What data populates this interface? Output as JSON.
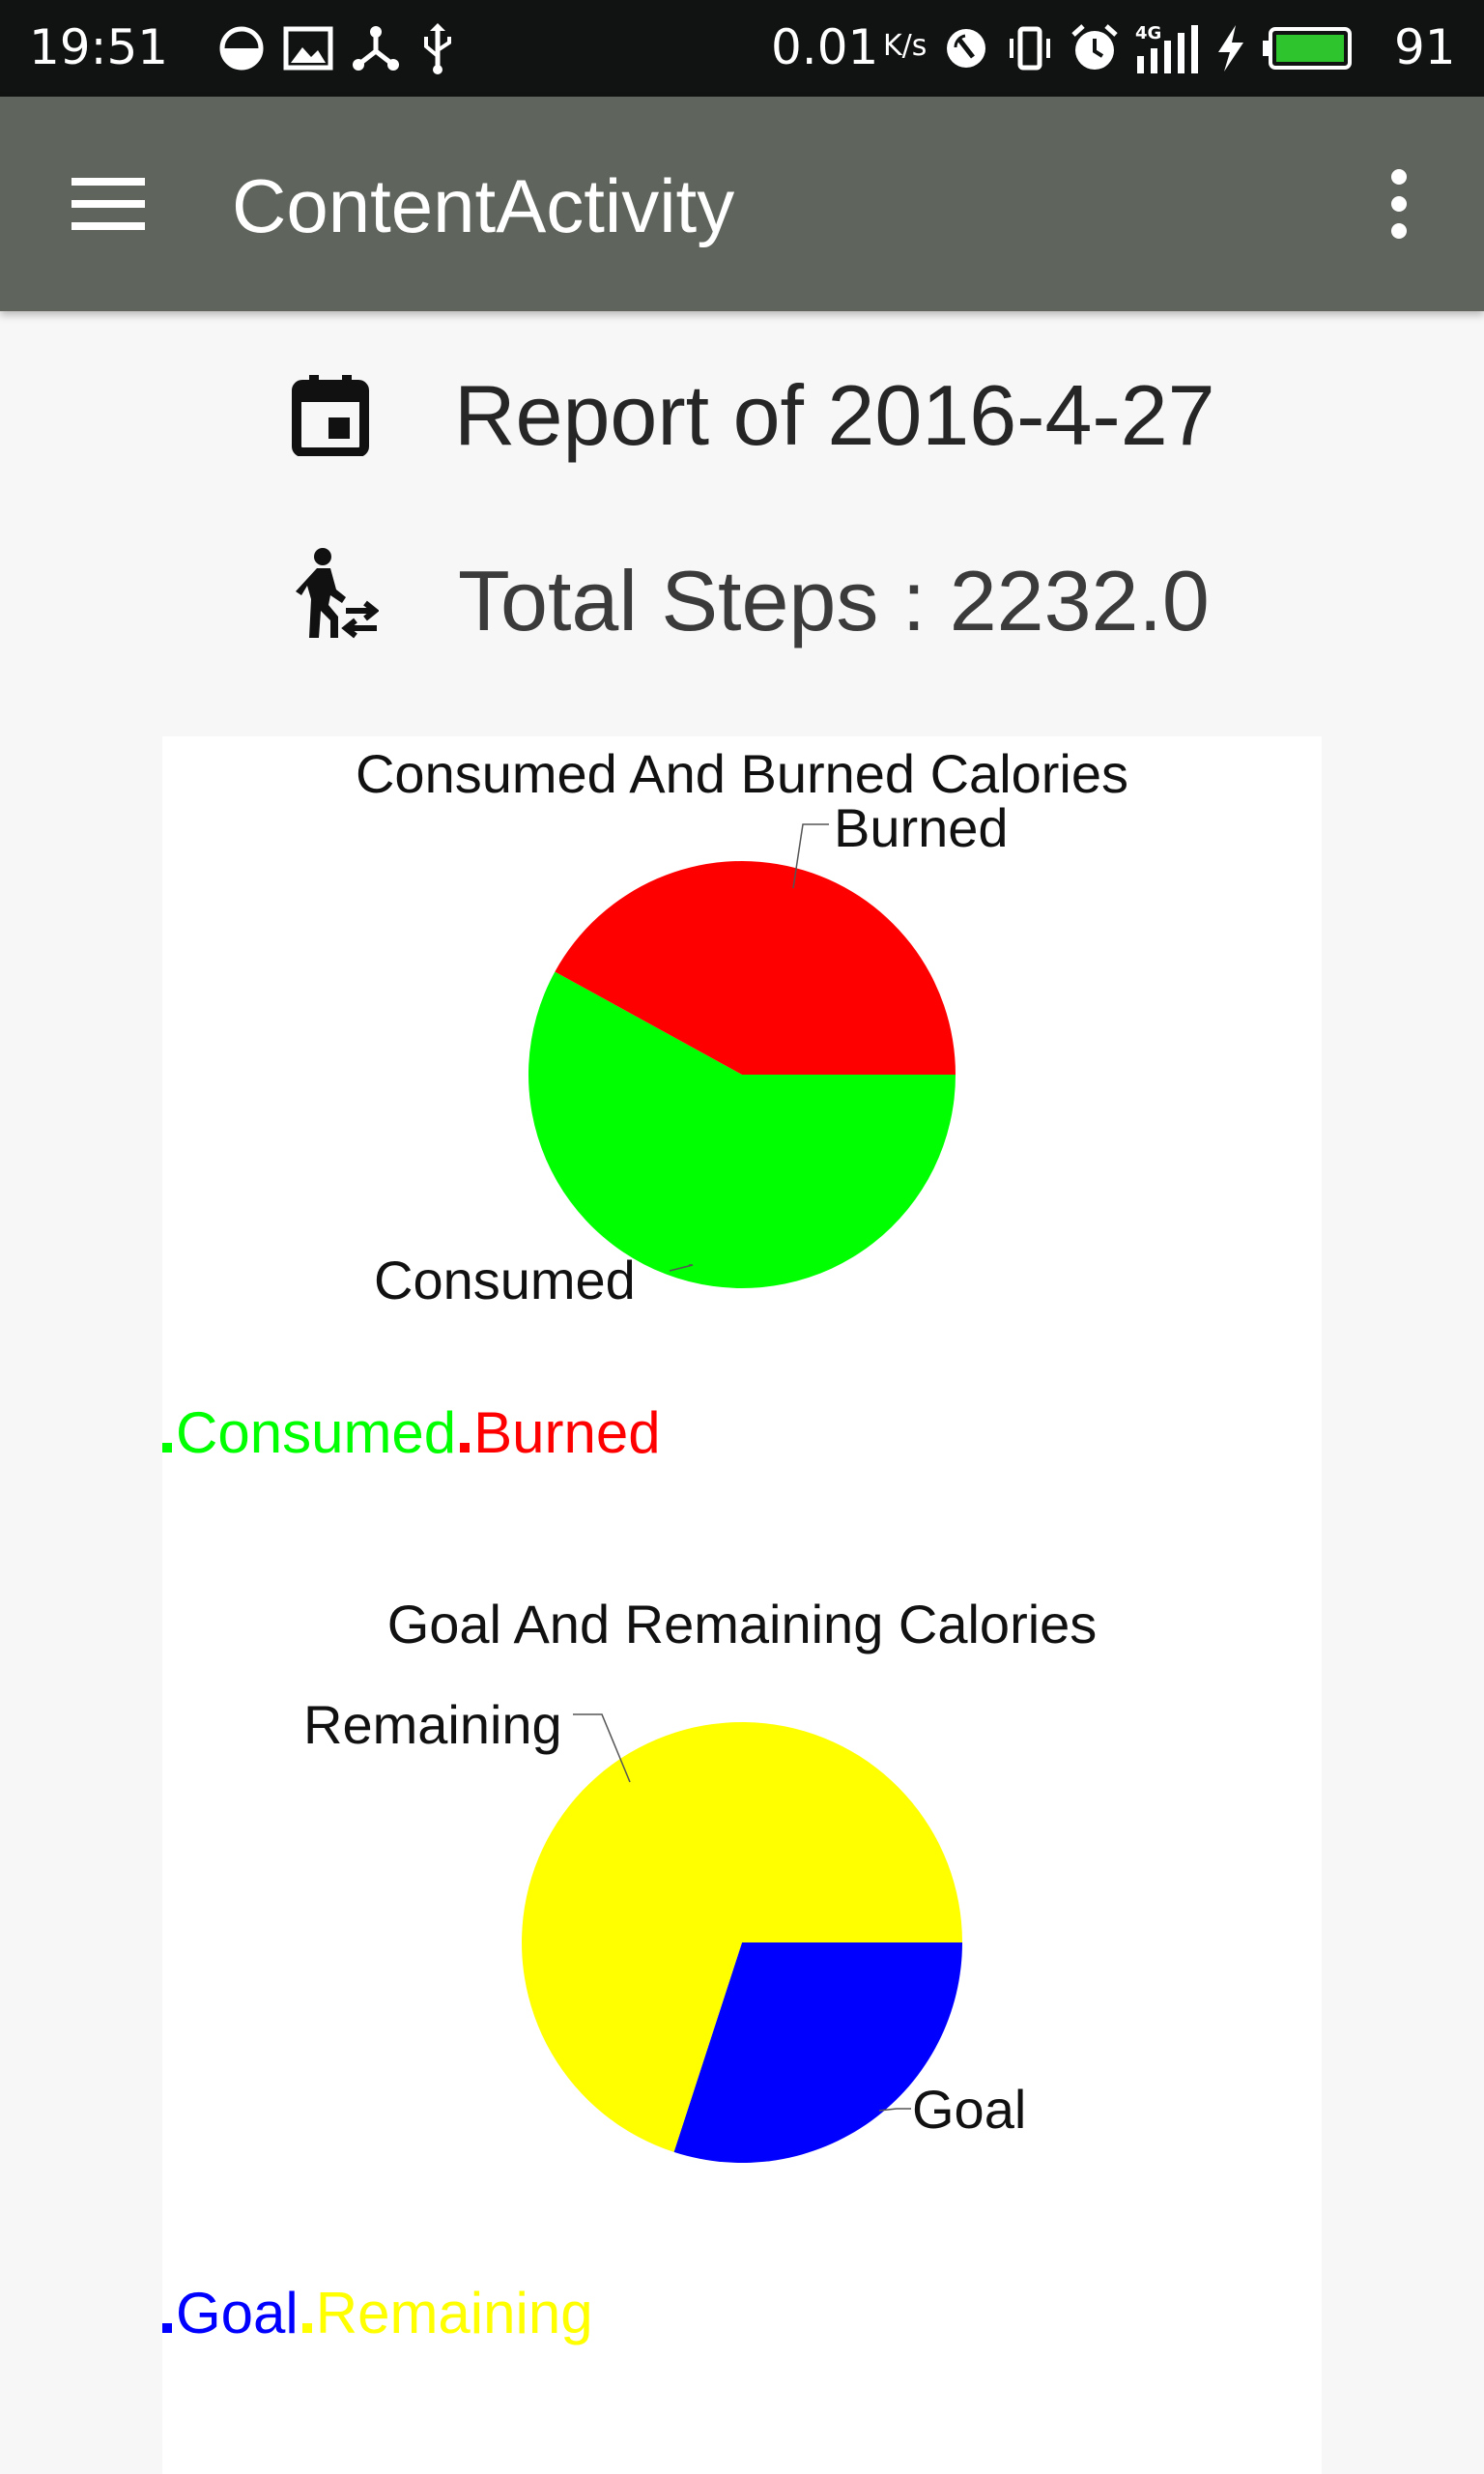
{
  "status_bar": {
    "time": "19:51",
    "net_speed": "0.01",
    "speed_unit": "K/s",
    "battery_level": "91",
    "left_icons": [
      "half-circle-icon",
      "image-icon",
      "share-icon",
      "usb-icon"
    ],
    "right_icons": [
      "nfc-icon",
      "vibrate-icon",
      "alarm-icon",
      "signal-4g-icon",
      "charging-icon",
      "battery-icon"
    ],
    "battery_color": "#2ec42e"
  },
  "app_bar": {
    "title": "ContentActivity",
    "background": "#5f645c"
  },
  "report": {
    "text": "Report of 2016-4-27"
  },
  "steps": {
    "text": "Total Steps : 2232.0"
  },
  "chart_data": [
    {
      "type": "pie",
      "title": "Consumed And Burned  Calories",
      "categories": [
        "Consumed",
        "Burned"
      ],
      "values": [
        58,
        42
      ],
      "colors": [
        "#00ff00",
        "#ff0000"
      ],
      "legend": [
        {
          "label": "Consumed",
          "color": "#00ff00"
        },
        {
          "label": "Burned",
          "color": "#ff0000"
        }
      ],
      "legend_position": "bottom-left"
    },
    {
      "type": "pie",
      "title": "Goal And Remaining Calories",
      "categories": [
        "Goal",
        "Remaining"
      ],
      "values": [
        30,
        70
      ],
      "colors": [
        "#0000ff",
        "#ffff00"
      ],
      "legend": [
        {
          "label": "Goal",
          "color": "#0000ff"
        },
        {
          "label": "Remaining",
          "color": "#ffff00"
        }
      ],
      "legend_position": "bottom-left"
    }
  ]
}
